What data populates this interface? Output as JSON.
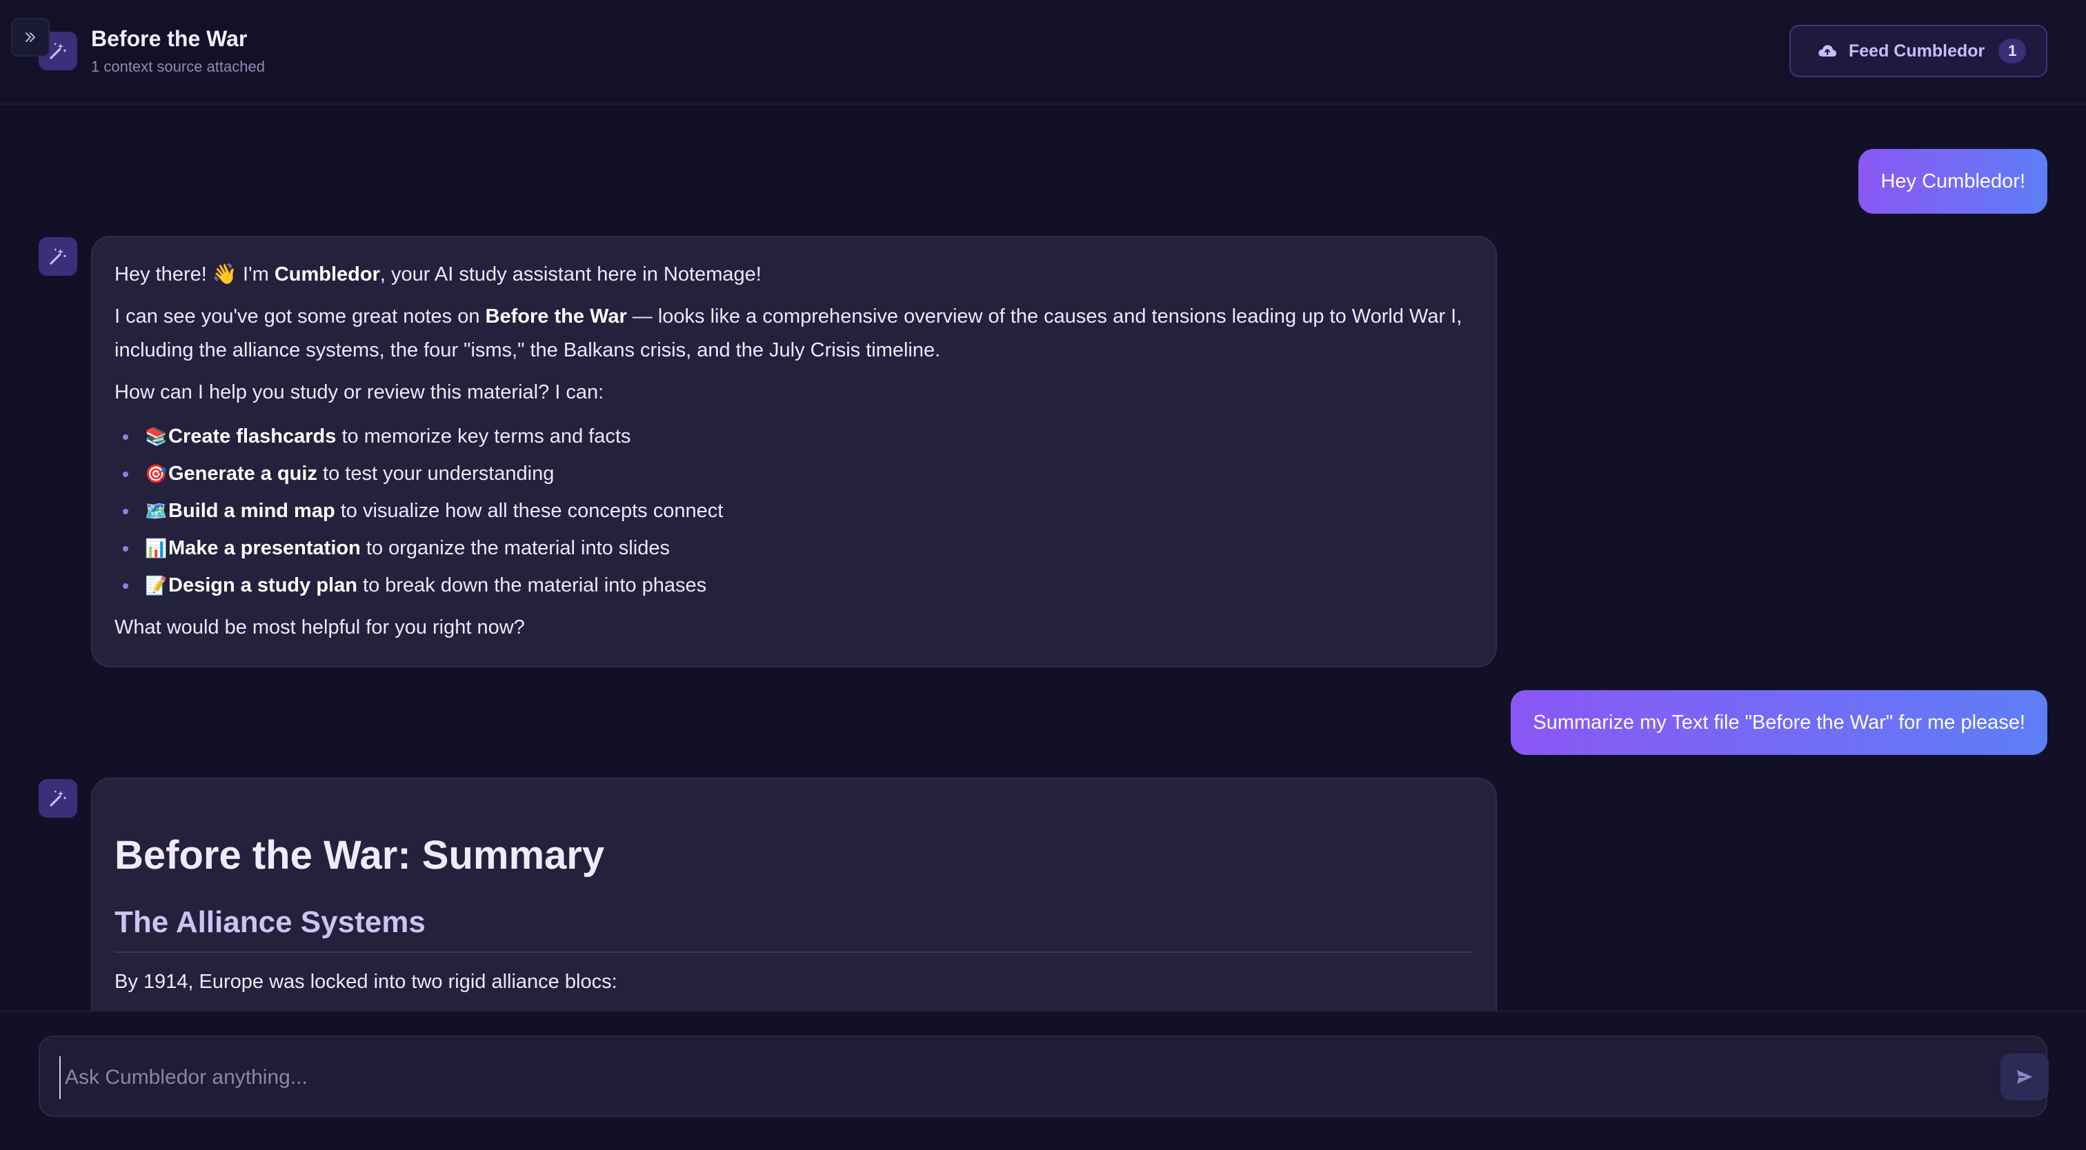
{
  "header": {
    "title": "Before the War",
    "subtitle": "1 context source attached",
    "feed_button_label": "Feed Cumbledor",
    "feed_count": "1",
    "sidebar_toggle_glyph": "»"
  },
  "messages": [
    {
      "role": "user",
      "text": "Hey Cumbledor!"
    },
    {
      "role": "assistant",
      "greeting": {
        "pre": "Hey there! ",
        "wave": "👋",
        "mid": " I'm ",
        "name": "Cumbledor",
        "post": ", your AI study assistant here in Notemage!"
      },
      "context": {
        "pre": "I can see you've got some great notes on ",
        "topic": "Before the War",
        "post": " — looks like a comprehensive overview of the causes and tensions leading up to World War I, including the alliance systems, the four \"isms,\" the Balkans crisis, and the July Crisis timeline."
      },
      "offer": "How can I help you study or review this material? I can:",
      "options": [
        {
          "emoji": "📚",
          "bold": "Create flashcards",
          "rest": " to memorize key terms and facts"
        },
        {
          "emoji": "🎯",
          "bold": "Generate a quiz",
          "rest": " to test your understanding"
        },
        {
          "emoji": "🗺️",
          "bold": "Build a mind map",
          "rest": " to visualize how all these concepts connect"
        },
        {
          "emoji": "📊",
          "bold": "Make a presentation",
          "rest": " to organize the material into slides"
        },
        {
          "emoji": "📝",
          "bold": "Design a study plan",
          "rest": " to break down the material into phases"
        }
      ],
      "closing": "What would be most helpful for you right now?"
    },
    {
      "role": "user",
      "text": "Summarize my Text file \"Before the War\" for me please!"
    },
    {
      "role": "assistant",
      "heading": "Before the War: Summary",
      "subheading": "The Alliance Systems",
      "paragraph": "By 1914, Europe was locked into two rigid alliance blocs:"
    }
  ],
  "composer": {
    "placeholder": "Ask Cumbledor anything...",
    "value": ""
  },
  "icons": {
    "avatar": "magic-wand-icon",
    "feed": "cloud-upload-icon",
    "send": "send-icon",
    "toggle": "double-chevron-right-icon"
  },
  "colors": {
    "background": "#111027",
    "accent": "#8b57f5",
    "accent_end": "#5d7ef6",
    "bubble": "#23213b"
  }
}
